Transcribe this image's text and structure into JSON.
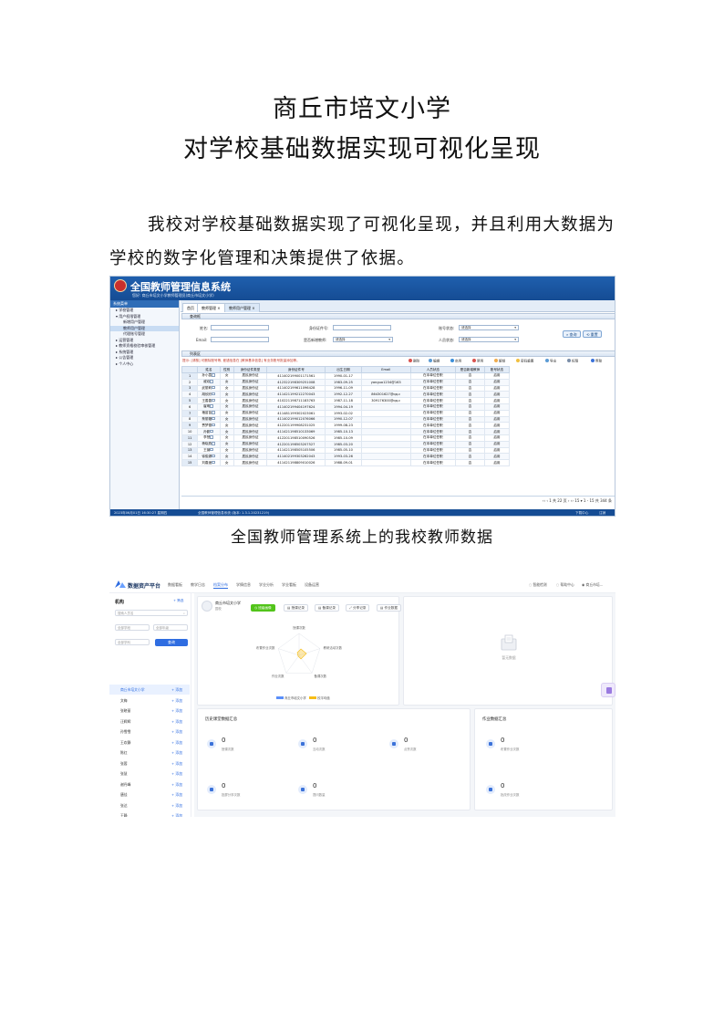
{
  "document": {
    "title_line1": "商丘市培文小学",
    "title_line2": "对学校基础数据实现可视化呈现",
    "paragraph": "我校对学校基础数据实现了可视化呈现，并且利用大数据为学校的数字化管理和决策提供了依据。",
    "caption1": "全国教师管理系统上的我校教师数据"
  },
  "screenshot1": {
    "app_title": "全国教师管理信息系统",
    "subtitle": "您好: 商丘市培文小学教师管理员(商丘市培文小学)",
    "sidebar_header": "系统菜单",
    "sidebar_items": [
      "学校管理",
      "用户权限管理",
      "新增用户管理",
      "代理账号管理",
      "运营管理",
      "教师资格校验审核管理",
      "系统管理",
      "公告管理",
      "个人中心"
    ],
    "tabs": [
      "首页",
      "教师管理 ×",
      "教师用户管理 ×"
    ],
    "search_bar_label": "查询框",
    "form": {
      "name_label": "姓名:",
      "id_label": "身份证件号:",
      "status_label": "账号状态:",
      "status_value": "请选择",
      "email_label": "Email:",
      "is_teacher_label": "是否新增教师:",
      "is_teacher_value": "请选择",
      "person_status_label": "人员状态:",
      "person_status_value": "请选择",
      "query_button": "查询",
      "reset_button": "重置"
    },
    "list_label": "列表区",
    "note": "提示: [请核] 可删除账号等, 差错信息在 [教师基本信息] 有业务账号批量添加等。",
    "toolbar": [
      "删除",
      "编辑",
      "启用",
      "禁用",
      "解锁",
      "密码重置",
      "导出",
      "权限",
      "帮助"
    ],
    "columns": [
      "",
      "姓名",
      "性别",
      "身份证件类型",
      "身份证件号",
      "出生日期",
      "Email",
      "人员状态",
      "是否新增教师",
      "账号状态"
    ],
    "rows": [
      [
        "1",
        "孙小霞",
        "女",
        "居民身份证",
        "411402199001171561",
        "1990-01-17",
        "",
        "在本单位任职",
        "否",
        "启用"
      ],
      [
        "2",
        "戚欢",
        "女",
        "居民身份证",
        "412322198309251008",
        "1983-09-25",
        "yanguo1234@163",
        "在本单位任职",
        "否",
        "启用"
      ],
      [
        "3",
        "武丽莉",
        "女",
        "居民身份证",
        "411402199611096428",
        "1996-11-09",
        "",
        "在本单位任职",
        "否",
        "启用"
      ],
      [
        "4",
        "胡欣欣",
        "女",
        "居民身份证",
        "411421199212270043",
        "1992-12-27",
        "864301627@qq.c",
        "在本单位任职",
        "否",
        "启用"
      ],
      [
        "5",
        "王善善",
        "女",
        "居民身份证",
        "410221198711183763",
        "1987-11-18",
        "309176300@qq.c",
        "在本单位任职",
        "否",
        "启用"
      ],
      [
        "6",
        "崔明",
        "女",
        "居民身份证",
        "411402199404197624",
        "1994-04-19",
        "",
        "在本单位任职",
        "否",
        "启用"
      ],
      [
        "7",
        "褚苗苗",
        "女",
        "居民身份证",
        "411481199302023061",
        "1993-02-02",
        "",
        "在本单位任职",
        "否",
        "启用"
      ],
      [
        "8",
        "蔡丽璐",
        "女",
        "居民身份证",
        "411402199012076066",
        "1990-12-07",
        "",
        "在本单位任职",
        "否",
        "启用"
      ],
      [
        "9",
        "贾梦雪",
        "女",
        "居民身份证",
        "412201199908231025",
        "1999-08-23",
        "",
        "在本单位任职",
        "否",
        "启用"
      ],
      [
        "10",
        "孙影",
        "女",
        "居民身份证",
        "411421198510133069",
        "1985-10-13",
        "",
        "在本单位任职",
        "否",
        "启用"
      ],
      [
        "11",
        "李慧",
        "女",
        "居民身份证",
        "412201198510090526",
        "1985-10-09",
        "",
        "在本单位任职",
        "否",
        "启用"
      ],
      [
        "12",
        "杨晓燕",
        "女",
        "居民身份证",
        "412201198503207527",
        "1985-03-20",
        "",
        "在本单位任职",
        "否",
        "启用"
      ],
      [
        "13",
        "王薇",
        "女",
        "居民身份证",
        "411421198505105506",
        "1985-05-10",
        "",
        "在本单位任职",
        "否",
        "启用"
      ],
      [
        "14",
        "徐俊娜",
        "女",
        "居民身份证",
        "411402199303262043",
        "1993-03-26",
        "",
        "在本单位任职",
        "否",
        "启用"
      ],
      [
        "15",
        "刘春遥",
        "女",
        "居民身份证",
        "411421198809010026",
        "1988-09-01",
        "",
        "在本单位任职",
        "否",
        "启用"
      ]
    ],
    "pager": "‹‹ ‹ 1 共 22 页 › ›› 15 ▾ 1 - 15 共 344 条",
    "footer_left": "2023年06月01日 16:30:27 星期四",
    "footer_mid": "全国教师管理信息系统 (版本: 1.3.1.20231219)",
    "footer_right1": "下载中心",
    "footer_right2": "注销"
  },
  "screenshot2": {
    "brand": "数据资产平台",
    "menu": [
      "数据看板",
      "教学日志",
      "档案分布",
      "学情信息",
      "学业分析",
      "学业看板",
      "设备运营"
    ],
    "menu_active_index": 2,
    "right_items": [
      "智能检测",
      "帮助中心",
      "商丘市培..."
    ],
    "sidebar_title": "机构",
    "sidebar_link": "+ 筛选",
    "search_placeholder": "搜索人员名",
    "select1": "全部学段",
    "select2": "全部年级",
    "select3": "全部学科",
    "query_button": "查询",
    "org_items": [
      {
        "name": "商丘市培文小学",
        "action": "+ 添加"
      },
      {
        "name": "文梅",
        "action": "+ 添加"
      },
      {
        "name": "张晓丽",
        "action": "+ 添加"
      },
      {
        "name": "汪辉辉",
        "action": "+ 添加"
      },
      {
        "name": "孙雪雪",
        "action": "+ 添加"
      },
      {
        "name": "王欢静",
        "action": "+ 添加"
      },
      {
        "name": "陈红",
        "action": "+ 添加"
      },
      {
        "name": "张蓉",
        "action": "+ 添加"
      },
      {
        "name": "张慧",
        "action": "+ 添加"
      },
      {
        "name": "谢丹峰",
        "action": "+ 添加"
      },
      {
        "name": "唐佳",
        "action": "+ 添加"
      },
      {
        "name": "张达",
        "action": "+ 添加"
      },
      {
        "name": "王静",
        "action": "+ 添加"
      },
      {
        "name": "张莉",
        "action": "+ 添加"
      }
    ],
    "school_name": "商丘市培文小学",
    "school_sub": "园校",
    "chips": [
      "班级画像",
      "授课记录",
      "备课记录",
      "分享记录",
      "作业数据"
    ],
    "radar_labels": [
      "授课次数",
      "教研活动次数",
      "备课次数",
      "作业次数",
      "布置作业次数"
    ],
    "legend": [
      {
        "label": "商丘市培文小学",
        "color": "#5b8ff9"
      },
      {
        "label": "校平均值",
        "color": "#f6bd16"
      }
    ],
    "empty_text": "暂无数据",
    "history_title": "历史课堂数据汇总",
    "history_stats": [
      {
        "value": "0",
        "label": "授课次数"
      },
      {
        "value": "0",
        "label": "互动次数"
      },
      {
        "value": "0",
        "label": "点赞次数"
      },
      {
        "value": "0",
        "label": "投屏分享次数"
      },
      {
        "value": "0",
        "label": "提问数量"
      }
    ],
    "homework_title": "作业数据汇总",
    "homework_stats": [
      {
        "value": "0",
        "label": "布置作业次数"
      },
      {
        "value": "0",
        "label": "批改作业次数"
      }
    ]
  }
}
